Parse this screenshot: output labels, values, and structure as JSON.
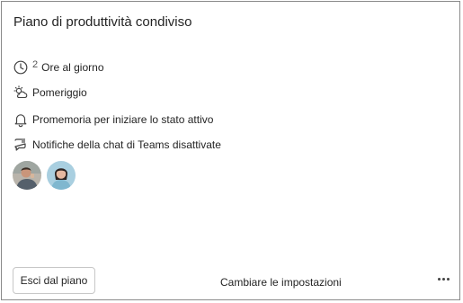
{
  "card": {
    "title": "Piano di produttività condiviso"
  },
  "details": {
    "hours_value": "2",
    "hours_label": "Ore al giorno",
    "time_of_day": "Pomeriggio",
    "reminder": "Promemoria per iniziare lo stato attivo",
    "teams_notifications": "Notifiche della chat di Teams disattivate"
  },
  "footer": {
    "leave_button": "Esci dal piano",
    "change_settings": "Cambiare le impostazioni"
  },
  "icons": {
    "hours": "clock-icon",
    "time_of_day": "weather-sunny-cloud-icon",
    "reminder": "bell-icon",
    "teams": "chat-bell-off-icon",
    "more": "more-horizontal-icon"
  },
  "colors": {
    "border": "#8a8a8a",
    "text": "#242424"
  }
}
